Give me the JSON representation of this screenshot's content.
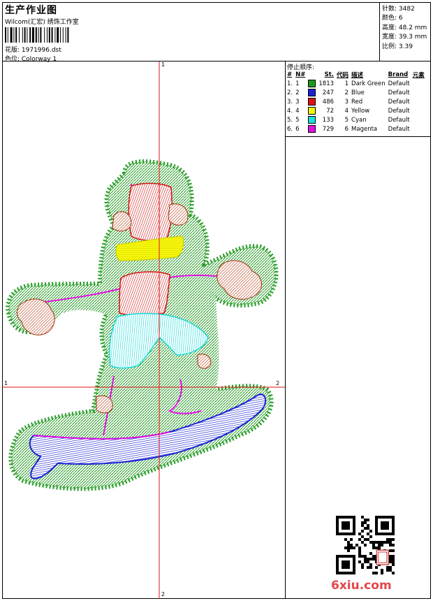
{
  "header": {
    "title": "生产作业图",
    "company": "Wilcom(汇宏) 绣饰工作室",
    "design_label": "花版: 1971996.dst",
    "colorway_label": "色位: Colorway 1"
  },
  "specs": [
    {
      "text": "针数: 3482"
    },
    {
      "text": "颜色: 6"
    },
    {
      "text": "高度: 48.2 mm"
    },
    {
      "text": "宽度: 39.3 mm"
    },
    {
      "text": "比例: 3.39"
    }
  ],
  "stop_sequence": {
    "title": "停止顺序:",
    "columns": [
      "#",
      "N#",
      "St.",
      "代码",
      "描述",
      "Brand",
      "元素"
    ],
    "rows": [
      {
        "idx": "1.",
        "n": "1",
        "color": "#1a9a1a",
        "stitches": "1813",
        "code": "1",
        "desc": "Dark Green",
        "brand": "Default",
        "elements": ""
      },
      {
        "idx": "2.",
        "n": "2",
        "color": "#1a22d4",
        "stitches": "247",
        "code": "2",
        "desc": "Blue",
        "brand": "Default",
        "elements": ""
      },
      {
        "idx": "3.",
        "n": "3",
        "color": "#e01010",
        "stitches": "486",
        "code": "3",
        "desc": "Red",
        "brand": "Default",
        "elements": ""
      },
      {
        "idx": "4.",
        "n": "4",
        "color": "#f5f50a",
        "stitches": "72",
        "code": "4",
        "desc": "Yellow",
        "brand": "Default",
        "elements": ""
      },
      {
        "idx": "5.",
        "n": "5",
        "color": "#1ae0e0",
        "stitches": "133",
        "code": "5",
        "desc": "Cyan",
        "brand": "Default",
        "elements": ""
      },
      {
        "idx": "6.",
        "n": "6",
        "color": "#e010e0",
        "stitches": "729",
        "code": "6",
        "desc": "Magenta",
        "brand": "Default",
        "elements": ""
      }
    ]
  },
  "axes": {
    "top": "1",
    "bottom": "2",
    "left": "1",
    "right": "2"
  },
  "watermark": "6xiu.com"
}
